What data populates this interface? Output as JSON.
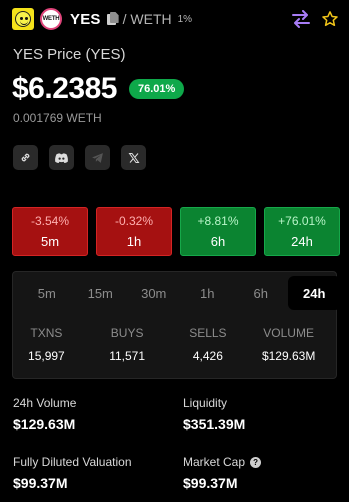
{
  "header": {
    "symbol": "YES",
    "pair": "/ WETH",
    "fee": "1%",
    "chain_logo_text": "WETH",
    "icons": [
      "token-logo",
      "chain-logo",
      "copy-icon",
      "swap-icon",
      "star-icon"
    ],
    "accent": "#a77cf5",
    "star_color": "#f0c419"
  },
  "price": {
    "label": "YES Price (YES)",
    "usd": "$6.2385",
    "change": "76.01%",
    "weth": "0.001769 WETH"
  },
  "socials": [
    "link-icon",
    "discord-icon",
    "telegram-icon",
    "x-icon"
  ],
  "changes": [
    {
      "value": "-3.54%",
      "period": "5m",
      "trend": "negative"
    },
    {
      "value": "-0.32%",
      "period": "1h",
      "trend": "negative"
    },
    {
      "value": "+8.81%",
      "period": "6h",
      "trend": "positive"
    },
    {
      "value": "+76.01%",
      "period": "24h",
      "trend": "positive"
    }
  ],
  "timeframe_tabs": [
    "5m",
    "15m",
    "30m",
    "1h",
    "6h",
    "24h"
  ],
  "selected_tab": "24h",
  "stats": [
    {
      "label": "TXNS",
      "value": "15,997"
    },
    {
      "label": "BUYS",
      "value": "11,571"
    },
    {
      "label": "SELLS",
      "value": "4,426"
    },
    {
      "label": "VOLUME",
      "value": "$129.63M"
    }
  ],
  "metrics": {
    "volume_24h": {
      "label": "24h Volume",
      "value": "$129.63M"
    },
    "liquidity": {
      "label": "Liquidity",
      "value": "$351.39M"
    },
    "fdv": {
      "label": "Fully Diluted Valuation",
      "value": "$99.37M"
    },
    "market_cap": {
      "label": "Market Cap",
      "value": "$99.37M"
    }
  },
  "colors": {
    "positive": "#0ea84a",
    "negative": "#a51111",
    "background": "#000000"
  }
}
